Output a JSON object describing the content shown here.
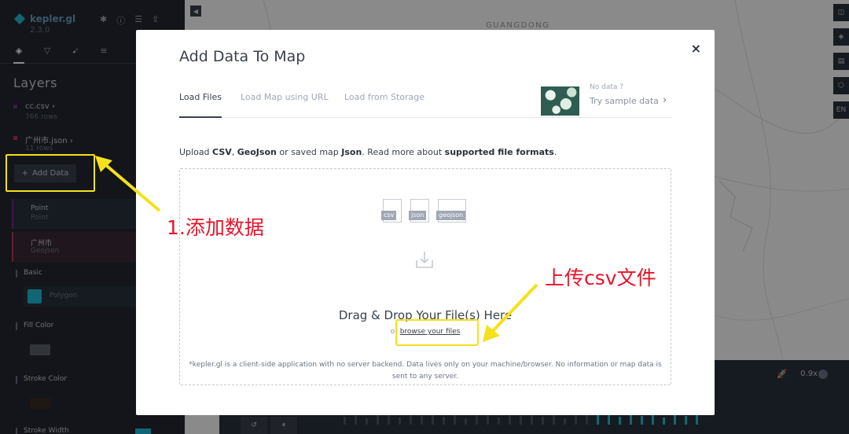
{
  "app": {
    "name": "kepler.gl",
    "version": "2.3.0",
    "top_icons": [
      "bug-icon",
      "info-icon",
      "database-icon",
      "share-icon"
    ],
    "accent_color": "#1fbad6"
  },
  "side_panel": {
    "tabs": [
      "layers-icon",
      "filter-icon",
      "interaction-icon",
      "basemap-icon"
    ],
    "active_tab": "layers-icon",
    "title": "Layers",
    "datasets": [
      {
        "name": "cc.csv",
        "rows": "766 rows",
        "color": "#6e2c87"
      },
      {
        "name": "广州市.json",
        "rows": "11 rows",
        "color": "#b43a5a"
      }
    ],
    "add_data_label": "Add Data",
    "add_data_icon": "+",
    "layers": [
      {
        "name": "Point",
        "type": "Point"
      },
      {
        "name": "广州市",
        "type": "Geojson"
      }
    ],
    "sections": {
      "basic": "Basic",
      "layer_type": "Polygon",
      "fill_color": "Fill Color",
      "stroke_color": "Stroke Color",
      "stroke_width": "Stroke Width"
    },
    "fill_swatch_color": "#5a5f66",
    "stroke_swatch_color": "#3a2a22"
  },
  "map": {
    "city_label": "GUANGDONG",
    "collapse_icon": "◀",
    "controls": [
      "◫",
      "◈",
      "▤",
      "⬡",
      "EN"
    ],
    "speed": "0.9x",
    "speed_icon": "🚀",
    "play_icon": "↺",
    "pause_icon": "⏸"
  },
  "modal": {
    "title": "Add Data To Map",
    "close_icon": "×",
    "tabs": [
      "Load Files",
      "Load Map using URL",
      "Load from Storage"
    ],
    "active_tab": "Load Files",
    "sample": {
      "no_data": "No data ?",
      "try_sample": "Try sample data",
      "chevron": "›"
    },
    "description": {
      "prefix": "Upload ",
      "csv": "CSV",
      "sep1": ", ",
      "geojson": "GeoJson",
      "middle": " or saved map ",
      "json": "Json",
      "suffix": ". Read more about ",
      "link": "supported file formats",
      "end": "."
    },
    "file_types": [
      "csv",
      "json",
      "geojson"
    ],
    "drag_drop": "Drag & Drop Your File(s) Here",
    "or": "or ",
    "browse": "browse your files",
    "disclaimer": "*kepler.gl is a client-side application with no server backend. Data lives only on your machine/browser. No information or map data is sent to any server."
  },
  "annotations": {
    "add_data": "1.添加数据",
    "upload_csv": "上传csv文件",
    "highlight_color": "#f5e11a",
    "text_color": "#e8142a"
  }
}
